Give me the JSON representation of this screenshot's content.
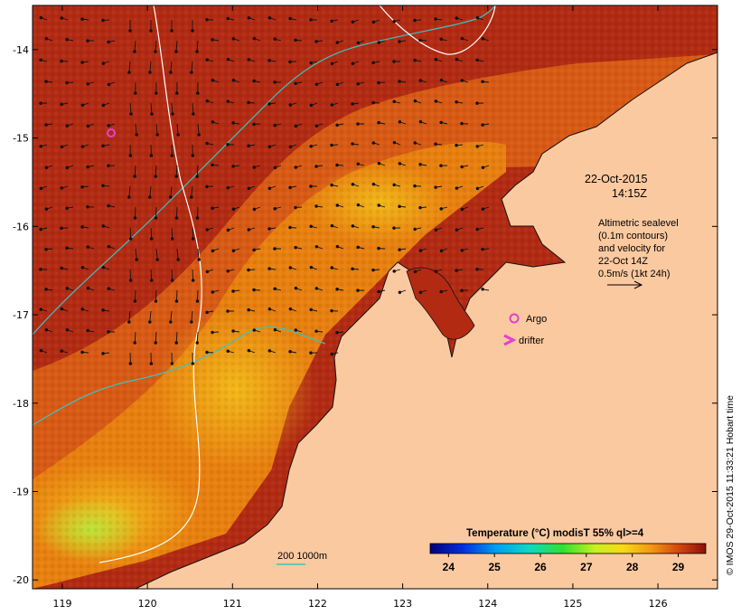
{
  "map": {
    "x_ticks": [
      "119",
      "120",
      "121",
      "122",
      "123",
      "124",
      "125",
      "126"
    ],
    "y_ticks": [
      "-14",
      "-15",
      "-16",
      "-17",
      "-18",
      "-19",
      "-20"
    ],
    "lon_range": [
      118.65,
      126.7
    ],
    "lat_range": [
      -20.1,
      -13.5
    ]
  },
  "date_block": {
    "line1": "22-Oct-2015",
    "line2": "14:15Z"
  },
  "altimetry_note": {
    "line1": "Altimetric sealevel",
    "line2": "(0.1m contours)",
    "line3": "and velocity for",
    "line4": "22-Oct 14Z",
    "line5": "0.5m/s (1kt 24h)"
  },
  "legend": {
    "argo_label": "Argo",
    "drifter_label": "drifter"
  },
  "isobath": {
    "label": "200  1000m"
  },
  "colorbar": {
    "title": "Temperature (°C) modisT 55% ql>=4",
    "ticks": [
      "24",
      "25",
      "26",
      "27",
      "28",
      "29"
    ],
    "range": [
      23.6,
      29.6
    ]
  },
  "credit": "© IMOS 29-Oct-2015 11:33:21 Hobart time",
  "colors": {
    "land": "#fbc9a0",
    "sst_warm": "#b22a12",
    "sst_mid": "#e67d10",
    "sst_cool": "#f2c21c",
    "isobath_200": "#3bc3c6",
    "isobath_1000": "#ffffff",
    "argo": "#e43fd2",
    "drifter": "#e43fd2",
    "vectors": "#111111"
  }
}
